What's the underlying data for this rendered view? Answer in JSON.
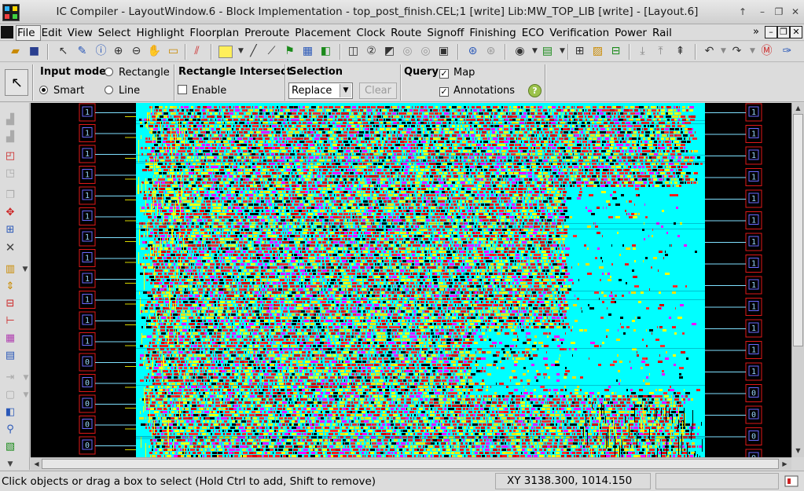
{
  "window": {
    "title": "IC Compiler - LayoutWindow.6 - Block Implementation - top_post_finish.CEL;1 [write]    Lib:MW_TOP_LIB [write] - [Layout.6]"
  },
  "menubar": {
    "items": [
      "File",
      "Edit",
      "View",
      "Select",
      "Highlight",
      "Floorplan",
      "Preroute",
      "Placement",
      "Clock",
      "Route",
      "Signoff",
      "Finishing",
      "ECO",
      "Verification",
      "Power",
      "Rail"
    ],
    "overflow": "»"
  },
  "options": {
    "input_mode": {
      "title": "Input mode",
      "options": [
        "Rectangle",
        "Smart",
        "Line"
      ],
      "selected": "Smart"
    },
    "rect_intersect": {
      "title": "Rectangle Intersect",
      "enable_label": "Enable",
      "enabled": false
    },
    "selection": {
      "title": "Selection",
      "mode": "Replace",
      "clear_label": "Clear"
    },
    "query": {
      "title": "Query",
      "map_label": "Map",
      "annotations_label": "Annotations",
      "map_checked": true,
      "annotations_checked": true,
      "help_label": "?"
    }
  },
  "status": {
    "message": "Click objects or drag a box to select (Hold Ctrl to add, Shift to remove)",
    "coords": "XY 3138.300, 1014.150"
  },
  "layout": {
    "left_pin_labels": [
      "1",
      "1",
      "1",
      "1",
      "1",
      "1",
      "1",
      "1",
      "1",
      "1",
      "1",
      "1",
      "0",
      "0",
      "0",
      "0",
      "0",
      "0"
    ],
    "right_pin_labels": [
      "1",
      "1",
      "1",
      "1",
      "1",
      "1",
      "1",
      "1",
      "1",
      "1",
      "1",
      "1",
      "1",
      "0",
      "0",
      "0",
      "0",
      "0"
    ],
    "colors": {
      "background": "#000000",
      "core": "#00ffff",
      "cell_red": "#ff1a1a",
      "cell_yellow": "#ffff00",
      "cell_magenta": "#ff00ff",
      "pin_red": "#e01818"
    }
  }
}
